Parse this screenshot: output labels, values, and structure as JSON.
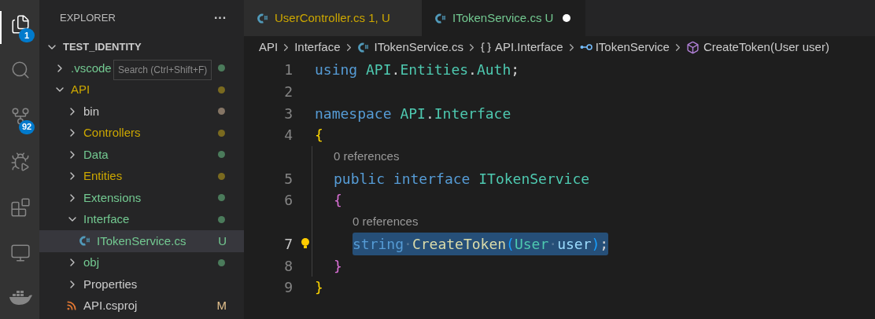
{
  "activity_bar": [
    {
      "kind": "files",
      "badge": "1",
      "selected": true
    },
    {
      "kind": "search",
      "selected": false
    },
    {
      "kind": "source-control",
      "badge": "92",
      "selected": false
    },
    {
      "kind": "debug",
      "selected": false
    },
    {
      "kind": "extensions",
      "selected": false
    },
    {
      "kind": "remote",
      "selected": false
    },
    {
      "kind": "docker",
      "selected": false
    }
  ],
  "tooltip": "Search (Ctrl+Shift+F)",
  "explorer": {
    "title": "EXPLORER",
    "menu": "···",
    "root": {
      "label": "TEST_IDENTITY",
      "expanded": true,
      "children": [
        {
          "label": ".vscode",
          "kind": "folder",
          "expanded": false,
          "color": "#4b7b5b",
          "selected": false
        },
        {
          "label": "API",
          "kind": "folder",
          "expanded": true,
          "color": "#7a6a1f",
          "selected": false,
          "children": [
            {
              "label": "bin",
              "kind": "folder",
              "expanded": false,
              "color": "#857565",
              "selected": false
            },
            {
              "label": "Controllers",
              "kind": "folder",
              "expanded": false,
              "color": "#7a6a1f",
              "selected": false
            },
            {
              "label": "Data",
              "kind": "folder",
              "expanded": false,
              "color": "#4b7b5b",
              "selected": false
            },
            {
              "label": "Entities",
              "kind": "folder",
              "expanded": false,
              "color": "#7a6a1f",
              "selected": false
            },
            {
              "label": "Extensions",
              "kind": "folder",
              "expanded": false,
              "color": "#4b7b5b",
              "selected": false
            },
            {
              "label": "Interface",
              "kind": "folder",
              "expanded": true,
              "color": "#4b7b5b",
              "selected": false,
              "children": [
                {
                  "label": "ITokenService.cs",
                  "kind": "csharp",
                  "badge": "U",
                  "color": "#73c991",
                  "selected": true
                }
              ]
            },
            {
              "label": "obj",
              "kind": "folder",
              "expanded": false,
              "color": "#4b7b5b",
              "selected": false
            },
            {
              "label": "Properties",
              "kind": "folder",
              "expanded": false,
              "selected": false
            },
            {
              "label": "API.csproj",
              "kind": "rss",
              "badge": "M",
              "color": "#e2c08d",
              "selected": false
            }
          ]
        }
      ]
    }
  },
  "tabs": [
    {
      "label": "UserController.cs",
      "decoration": "1, U",
      "color": "#cca700",
      "selected": false,
      "dirty": false
    },
    {
      "label": "ITokenService.cs",
      "decoration": "U",
      "color": "#73c991",
      "selected": true,
      "dirty": true
    }
  ],
  "breadcrumbs": [
    {
      "kind": "text",
      "label": "API"
    },
    {
      "kind": "text",
      "label": "Interface"
    },
    {
      "kind": "csharp",
      "label": "ITokenService.cs"
    },
    {
      "kind": "namespace",
      "label": "API.Interface"
    },
    {
      "kind": "interface",
      "label": "ITokenService"
    },
    {
      "kind": "method",
      "label": "CreateToken(User user)"
    }
  ],
  "code": [
    {
      "kind": "line",
      "number": "1",
      "active": false,
      "tokens": [
        {
          "text": "using ",
          "kind": "keyword"
        },
        {
          "text": "API",
          "kind": "type"
        },
        {
          "text": ".",
          "kind": "plain"
        },
        {
          "text": "Entities",
          "kind": "type"
        },
        {
          "text": ".",
          "kind": "plain"
        },
        {
          "text": "Auth",
          "kind": "type"
        },
        {
          "text": ";",
          "kind": "plain"
        }
      ]
    },
    {
      "kind": "line",
      "number": "2",
      "active": false
    },
    {
      "kind": "line",
      "number": "3",
      "active": false,
      "tokens": [
        {
          "text": "namespace ",
          "kind": "keyword"
        },
        {
          "text": "API",
          "kind": "type"
        },
        {
          "text": ".",
          "kind": "plain"
        },
        {
          "text": "Interface",
          "kind": "type"
        }
      ]
    },
    {
      "kind": "line",
      "number": "4",
      "active": false,
      "tokens": [
        {
          "text": "{",
          "kind": "brace1"
        }
      ],
      "children": [
        {
          "kind": "lens",
          "text": "0 references"
        },
        {
          "kind": "line",
          "number": "5",
          "active": false,
          "tokens": [
            {
              "text": "public interface ",
              "kind": "keyword"
            },
            {
              "text": "ITokenService",
              "kind": "type"
            }
          ]
        },
        {
          "kind": "line",
          "number": "6",
          "active": false,
          "tokens": [
            {
              "text": "{",
              "kind": "brace2"
            }
          ],
          "children": [
            {
              "kind": "lens",
              "text": "0 references"
            },
            {
              "kind": "line",
              "number": "7",
              "active": true,
              "selected": true,
              "lightbulb": true,
              "tokens": [
                {
                  "text": "string",
                  "kind": "keyword"
                },
                {
                  "text": "·",
                  "kind": "dot"
                },
                {
                  "text": "CreateToken",
                  "kind": "method"
                },
                {
                  "text": "(",
                  "kind": "paren"
                },
                {
                  "text": "User",
                  "kind": "type"
                },
                {
                  "text": "·",
                  "kind": "dot"
                },
                {
                  "text": "user",
                  "kind": "param"
                },
                {
                  "text": ")",
                  "kind": "paren"
                },
                {
                  "text": ";",
                  "kind": "plain"
                }
              ]
            }
          ]
        },
        {
          "kind": "line",
          "number": "8",
          "active": false,
          "tokens": [
            {
              "text": "}",
              "kind": "brace2"
            }
          ]
        }
      ]
    },
    {
      "kind": "line",
      "number": "9",
      "active": false,
      "tokens": [
        {
          "text": "}",
          "kind": "brace1"
        }
      ]
    }
  ]
}
